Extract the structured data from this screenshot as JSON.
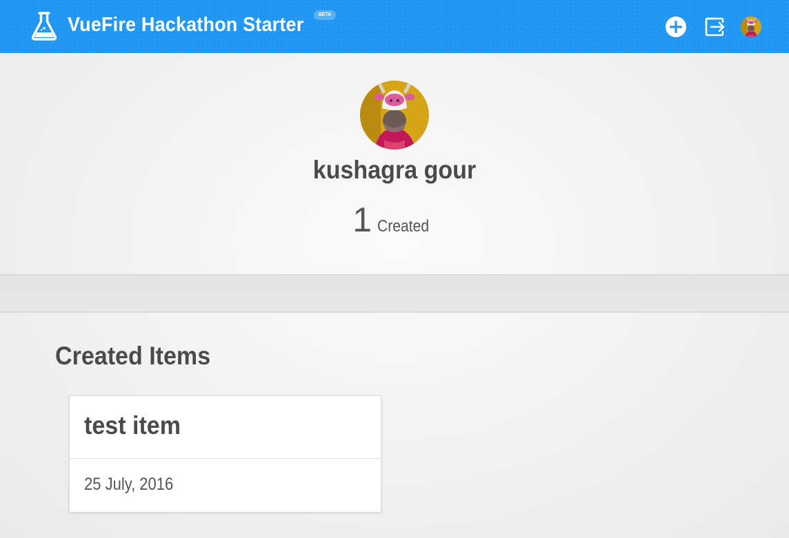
{
  "header": {
    "title": "VueFire Hackathon Starter",
    "badge": "BETA",
    "add_action_icon": "plus-circle-icon",
    "logout_action_icon": "logout-icon",
    "brand_color": "#2196f3"
  },
  "profile": {
    "name": "kushagra gour",
    "created_count": "1",
    "created_label": "Created"
  },
  "created_items": {
    "heading": "Created Items",
    "items": [
      {
        "title": "test item",
        "date": "25 July, 2016"
      }
    ]
  }
}
